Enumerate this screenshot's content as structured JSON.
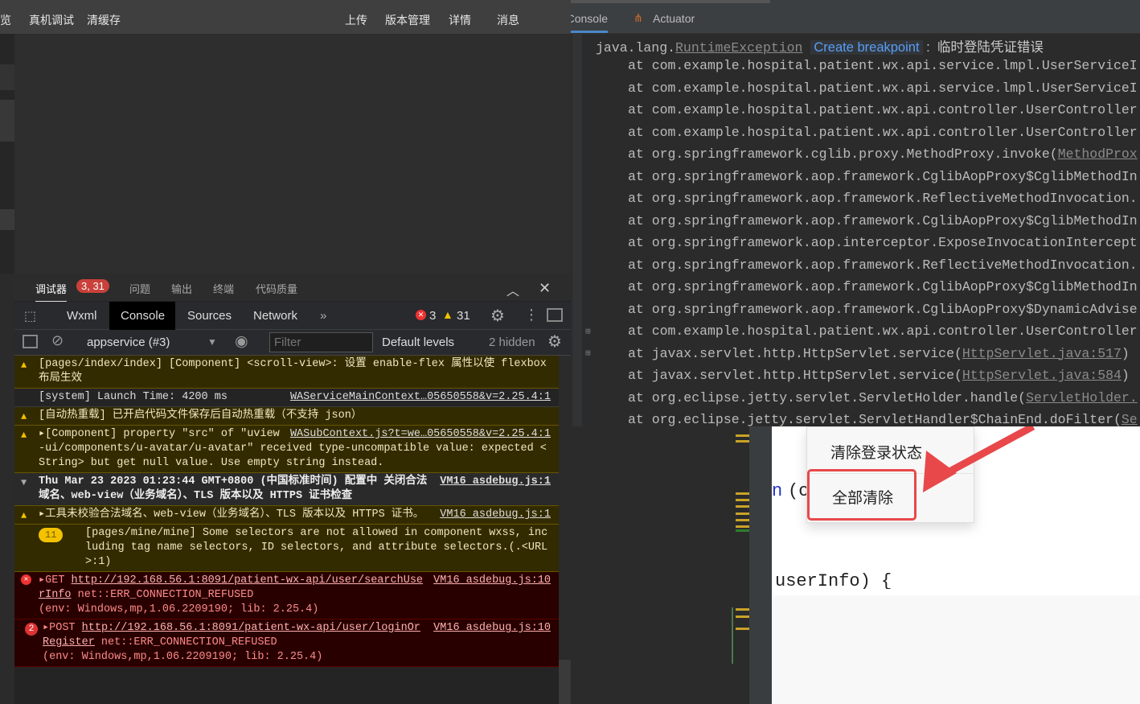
{
  "toolbar": {
    "left": [
      "览",
      "真机调试",
      "清缓存"
    ],
    "right": [
      "上传",
      "版本管理",
      "详情",
      "消息"
    ]
  },
  "debugger_tabs": {
    "items": [
      "调试器",
      "问题",
      "输出",
      "终端",
      "代码质量"
    ],
    "badge": "3, 31"
  },
  "devtools": {
    "tabs": [
      "Wxml",
      "Console",
      "Sources",
      "Network"
    ],
    "more": "»",
    "errors": "3",
    "warnings": "31"
  },
  "filter": {
    "context": "appservice (#3)",
    "placeholder": "Filter",
    "levels": "Default levels",
    "hidden": "2 hidden"
  },
  "console": [
    {
      "type": "warn",
      "text": "[pages/index/index] [Component] <scroll-view>: 设置 enable-flex 属性以使 flexbox 布局生效",
      "src": ""
    },
    {
      "type": "info",
      "text": "[system] Launch Time: 4200 ms",
      "src": "WAServiceMainContext…05650558&v=2.25.4:1"
    },
    {
      "type": "warn",
      "text": "[自动热重载] 已开启代码文件保存后自动热重载（不支持 json）",
      "src": ""
    },
    {
      "type": "warn",
      "text": "▸[Component] property \"src\" of \"uview-ui/components/u-avatar/u-avatar\" received type-uncompatible value: expected <String> but get null value. Use empty string instead.",
      "src": "WASubContext.js?t=we…05650558&v=2.25.4:1"
    },
    {
      "type": "group",
      "text": "Thu Mar 23 2023 01:23:44 GMT+0800 (中国标准时间) 配置中 关闭合法域名、web-view（业务域名）、TLS 版本以及 HTTPS 证书检查",
      "src": "VM16 asdebug.js:1"
    },
    {
      "type": "warn",
      "text": "▸工具未校验合法域名、web-view（业务域名）、TLS 版本以及 HTTPS 证书。",
      "src": "VM16 asdebug.js:1"
    },
    {
      "type": "warn",
      "count": "11",
      "text": "[pages/mine/mine] Some selectors are not allowed in component wxss, including tag name selectors, ID selectors, and attribute selectors.(.<URL>:1)",
      "src": ""
    },
    {
      "type": "err",
      "method": "▸GET ",
      "url": "http://192.168.56.1:8091/patient-wx-api/user/searchUserInfo",
      "text": " net::ERR_CONNECTION_REFUSED\n(env: Windows,mp,1.06.2209190; lib: 2.25.4)",
      "src": "VM16 asdebug.js:10"
    },
    {
      "type": "err",
      "count": "2",
      "method": "▸POST ",
      "url": "http://192.168.56.1:8091/patient-wx-api/user/loginOrRegister",
      "text": " net::ERR_CONNECTION_REFUSED\n(env: Windows,mp,1.06.2209190; lib: 2.25.4)",
      "src": "VM16 asdebug.js:10"
    }
  ],
  "ide_tabs": {
    "console": "Console",
    "actuator": "Actuator"
  },
  "exception": {
    "prefix": "java.lang.",
    "class": "RuntimeException",
    "action": "Create breakpoint",
    "message": " :  临时登陆凭证错误"
  },
  "stack": [
    {
      "t": "at com.example.hospital.patient.wx.api.service.lmpl.UserServiceI",
      "l": ""
    },
    {
      "t": "at com.example.hospital.patient.wx.api.service.lmpl.UserServiceI",
      "l": ""
    },
    {
      "t": "at com.example.hospital.patient.wx.api.controller.UserController",
      "l": ""
    },
    {
      "t": "at com.example.hospital.patient.wx.api.controller.UserController",
      "l": ""
    },
    {
      "t": "at org.springframework.cglib.proxy.MethodProxy.invoke(",
      "l": "MethodProx"
    },
    {
      "t": "at org.springframework.aop.framework.CglibAopProxy$CglibMethodIn",
      "l": ""
    },
    {
      "t": "at org.springframework.aop.framework.ReflectiveMethodInvocation.",
      "l": ""
    },
    {
      "t": "at org.springframework.aop.framework.CglibAopProxy$CglibMethodIn",
      "l": ""
    },
    {
      "t": "at org.springframework.aop.interceptor.ExposeInvocationIntercept",
      "l": ""
    },
    {
      "t": "at org.springframework.aop.framework.ReflectiveMethodInvocation.",
      "l": ""
    },
    {
      "t": "at org.springframework.aop.framework.CglibAopProxy$CglibMethodIn",
      "l": ""
    },
    {
      "t": "at org.springframework.aop.framework.CglibAopProxy$DynamicAdvise",
      "l": ""
    },
    {
      "t": "at com.example.hospital.patient.wx.api.controller.UserController",
      "l": ""
    },
    {
      "t": "at javax.servlet.http.HttpServlet.service(",
      "l": "HttpServlet.java:517",
      "e": ")"
    },
    {
      "t": "at javax.servlet.http.HttpServlet.service(",
      "l": "HttpServlet.java:584",
      "e": ")"
    },
    {
      "t": "at org.eclipse.jetty.servlet.ServletHolder.handle(",
      "l": "ServletHolder."
    },
    {
      "t": "at org.eclipse.jetty.servlet.ServletHandler$ChainEnd.doFilter(",
      "l": "Se"
    }
  ],
  "code": {
    "frag1": "n",
    "frag2": "(c",
    "frag3": "userInfo) {"
  },
  "menu": {
    "items": [
      "清除登录状态",
      "全部清除"
    ]
  }
}
